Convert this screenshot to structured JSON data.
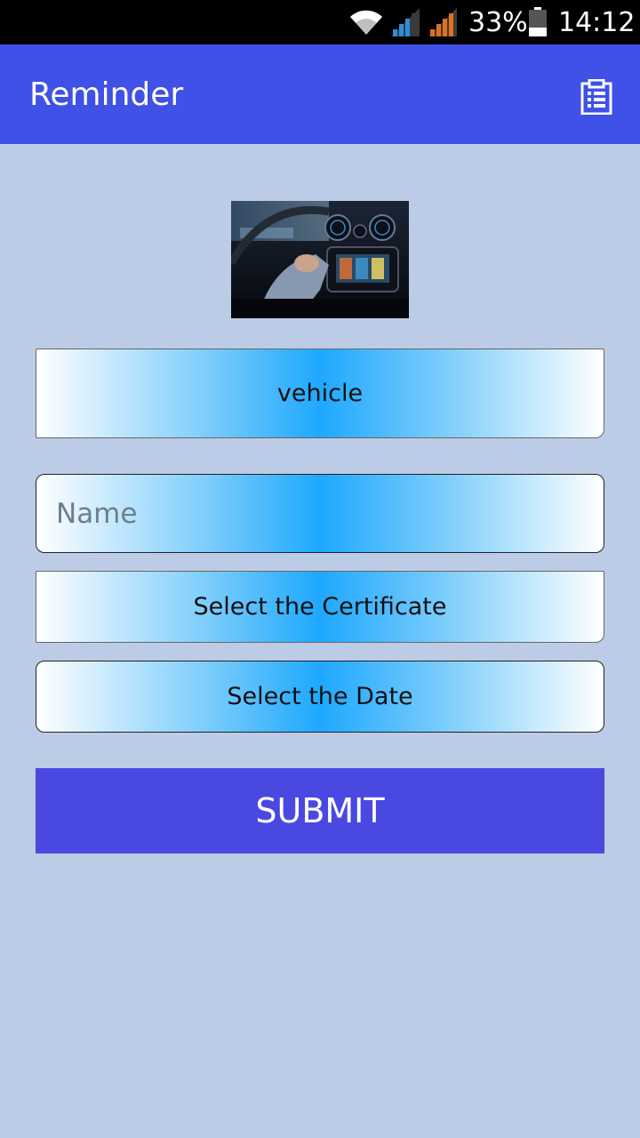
{
  "status_bar": {
    "battery_percent": "33%",
    "time": "14:12",
    "icons": [
      "wifi-icon",
      "signal-icon",
      "signal-icon",
      "battery-icon"
    ]
  },
  "app_bar": {
    "title": "Reminder",
    "action_icon": "clipboard-list-icon"
  },
  "header_image": {
    "subject": "car-dashboard-photo"
  },
  "form": {
    "vehicle_label": "vehicle",
    "name_placeholder": "Name",
    "name_value": "",
    "certificate_label": "Select the Certificate",
    "date_label": "Select the Date",
    "submit_label": "SUBMIT"
  },
  "colors": {
    "app_bar": "#3f51e6",
    "background": "#bdcce6",
    "submit": "#4949e1",
    "gradient_center": "#1ea8ff"
  }
}
